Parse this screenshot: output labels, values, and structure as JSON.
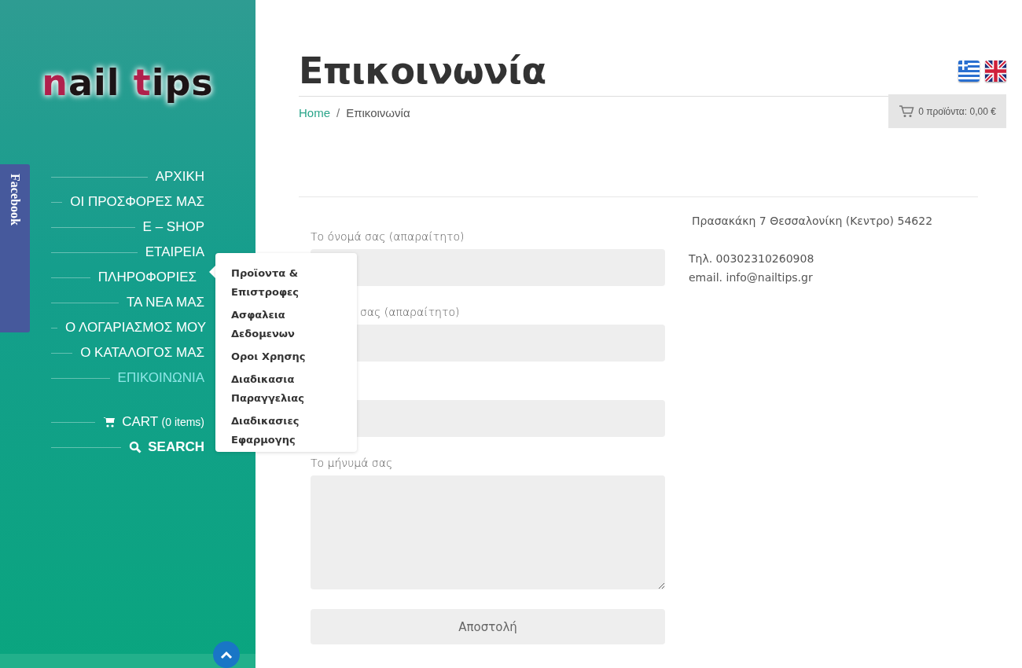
{
  "sidebar": {
    "logo": [
      {
        "text": "n",
        "accent": true
      },
      {
        "text": "ail ",
        "accent": false
      },
      {
        "text": "t",
        "accent": true
      },
      {
        "text": "ips",
        "accent": false
      }
    ],
    "facebook_tab": "Facebook",
    "nav": [
      {
        "label": "ΑΡΧΙΚΗ",
        "selected": false
      },
      {
        "label": "ΟΙ ΠΡΟΣΦΟΡΕΣ ΜΑΣ",
        "selected": false
      },
      {
        "label": "E – SHOP",
        "selected": false
      },
      {
        "label": "ΕΤΑΙΡΕΙΑ",
        "selected": false
      },
      {
        "label": "ΠΛΗΡΟΦΟΡΙΕΣ",
        "selected": false,
        "children": [
          "Προϊοντα & Επιστροφες",
          "Ασφαλεια Δεδομενων",
          "Οροι Χρησης",
          "Διαδικασια Παραγγελιας",
          "Διαδικασιες Εφαρμογης"
        ]
      },
      {
        "label": "ΤΑ ΝΕΑ ΜΑΣ",
        "selected": false
      },
      {
        "label": "Ο ΛΟΓΑΡΙΑΣΜΟΣ ΜΟΥ",
        "selected": false
      },
      {
        "label": "Ο ΚΑΤΑΛΟΓΟΣ ΜΑΣ",
        "selected": false
      },
      {
        "label": "ΕΠΙΚΟΙΝΩΝΙΑ",
        "selected": true
      }
    ],
    "cart": {
      "label": "CART",
      "count": "(0 items)"
    },
    "search": {
      "label": "SEARCH"
    }
  },
  "main": {
    "title": "Επικοινωνία",
    "breadcrumb_separator": "/",
    "breadcrumb": [
      {
        "label": "Home",
        "link": true
      },
      {
        "label": "Επικοινωνία",
        "link": false
      }
    ],
    "cart_summary": "0 προϊόντα: 0,00 €",
    "form": {
      "fields": [
        {
          "kind": "input",
          "label": "Το όνομά σας (απαραίτητο)",
          "covered": false
        },
        {
          "kind": "input",
          "label": "σας (απαραίτητο)",
          "covered": true
        },
        {
          "kind": "input",
          "covered": true
        },
        {
          "kind": "textarea",
          "label": "Το μήνυμά σας",
          "covered": false
        }
      ],
      "submit": "Αποστολή"
    },
    "contact": {
      "address": "Πρασακάκη 7 Θεσσαλονίκη (Κεντρο) 54622",
      "phone": "Τηλ. 00302310260908",
      "email": "email. info@nailtips.gr"
    }
  }
}
